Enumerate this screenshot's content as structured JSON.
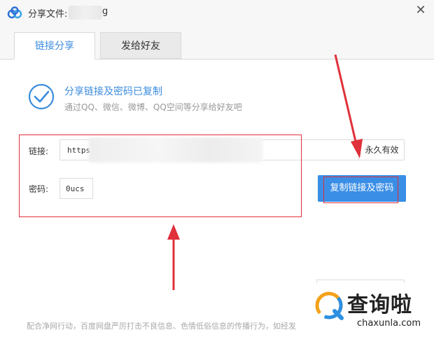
{
  "window": {
    "title_prefix": "分享文件:",
    "title_suffix": "g"
  },
  "tabs": [
    {
      "label": "链接分享",
      "active": true
    },
    {
      "label": "发给好友",
      "active": false
    }
  ],
  "status": {
    "title": "分享链接及密码已复制",
    "subtitle": "通过QQ、微信、微博、QQ空间等分享给好友吧"
  },
  "link": {
    "label": "链接:",
    "value": "https",
    "validity": "永久有效"
  },
  "password": {
    "label": "密码:",
    "value": "0ucs"
  },
  "copy_button": {
    "label": "复制链接及密码"
  },
  "footer": {
    "text": "配合净网行动，百度网盘严厉打击不良信息、色情低俗信息的传播行为，如经发"
  },
  "watermark": {
    "main": "查询啦",
    "sub": "chaxunla.com"
  },
  "colors": {
    "accent": "#3b8cde",
    "button": "#3a8ee6",
    "annotation_red": "#e0303a"
  },
  "icons": {
    "app_logo": "baidu-netdisk-cloud-icon",
    "check": "check-circle-icon",
    "close": "close-icon"
  }
}
